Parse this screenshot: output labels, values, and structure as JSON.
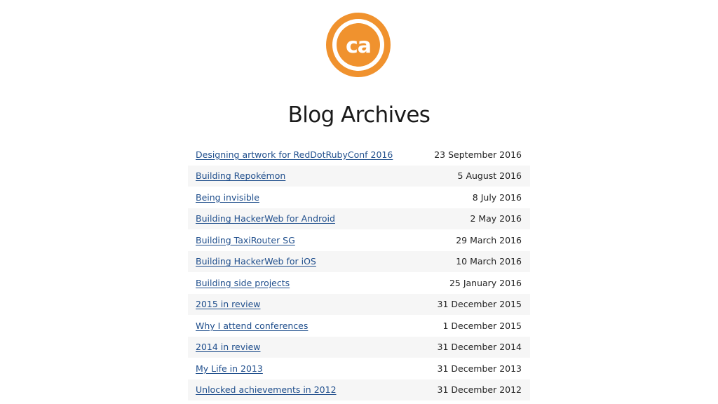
{
  "branding": {
    "logo_text": "ca",
    "logo_color": "#f0922e"
  },
  "page": {
    "title": "Blog Archives"
  },
  "colors": {
    "link": "#1f4e8c",
    "stripe": "#f6f6f6"
  },
  "posts": [
    {
      "title": "Designing artwork for RedDotRubyConf 2016",
      "date": "23 September 2016"
    },
    {
      "title": "Building Repokémon",
      "date": "5 August 2016"
    },
    {
      "title": "Being invisible",
      "date": "8 July 2016"
    },
    {
      "title": "Building HackerWeb for Android",
      "date": "2 May 2016"
    },
    {
      "title": "Building TaxiRouter SG",
      "date": "29 March 2016"
    },
    {
      "title": "Building HackerWeb for iOS",
      "date": "10 March 2016"
    },
    {
      "title": "Building side projects",
      "date": "25 January 2016"
    },
    {
      "title": "2015 in review",
      "date": "31 December 2015"
    },
    {
      "title": "Why I attend conferences",
      "date": "1 December 2015"
    },
    {
      "title": "2014 in review",
      "date": "31 December 2014"
    },
    {
      "title": "My Life in 2013",
      "date": "31 December 2013"
    },
    {
      "title": "Unlocked achievements in 2012",
      "date": "31 December 2012"
    }
  ]
}
